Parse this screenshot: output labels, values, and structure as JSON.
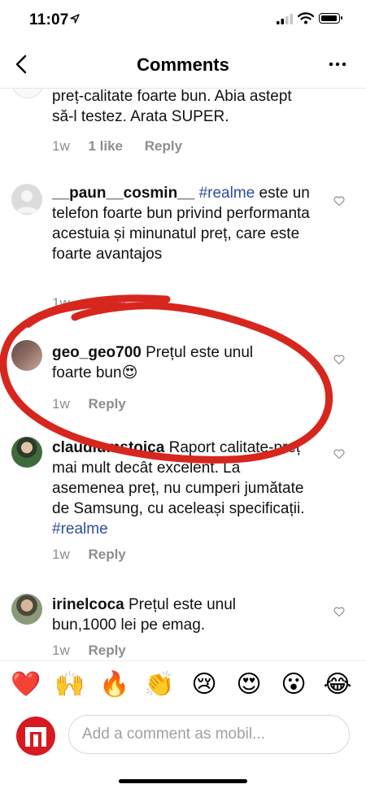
{
  "status_bar": {
    "time": "11:07"
  },
  "header": {
    "title": "Comments"
  },
  "comments": [
    {
      "user": "",
      "text": "preț-calitate foarte bun. Abia astept să-l testez. Arata SUPER.",
      "hashtag": "",
      "time": "1w",
      "likes": "1 like",
      "reply": "Reply"
    },
    {
      "user": "__paun__cosmin__",
      "text": "este un telefon foarte bun privind performanta  acestuia și minunatul preț, care este foarte avantajos",
      "hashtag": "#realme",
      "time": "1w",
      "reply": "Reply"
    },
    {
      "user": "geo_geo700",
      "text": "Prețul este unul foarte bun😍",
      "time": "1w",
      "reply": "Reply"
    },
    {
      "user": "claudiumstoica",
      "text": "Raport calitate-preț mai mult decât excelent. La asemenea preț, nu cumperi jumătate de Samsung, cu aceleași specificații.",
      "hashtag": "#realme",
      "time": "1w",
      "reply": "Reply"
    },
    {
      "user": "irinelcoca",
      "text": "Prețul este unul bun,1000 lei pe emag.",
      "time": "1w",
      "reply": "Reply"
    }
  ],
  "emoji_bar": [
    "❤️",
    "🙌",
    "🔥",
    "👏",
    "😢",
    "😍",
    "😮",
    "😂"
  ],
  "input": {
    "placeholder": "Add a comment as mobil..."
  },
  "colors": {
    "accent_red": "#d71920",
    "hashtag": "#2f4f9a",
    "meta_gray": "#8e8e8e"
  }
}
